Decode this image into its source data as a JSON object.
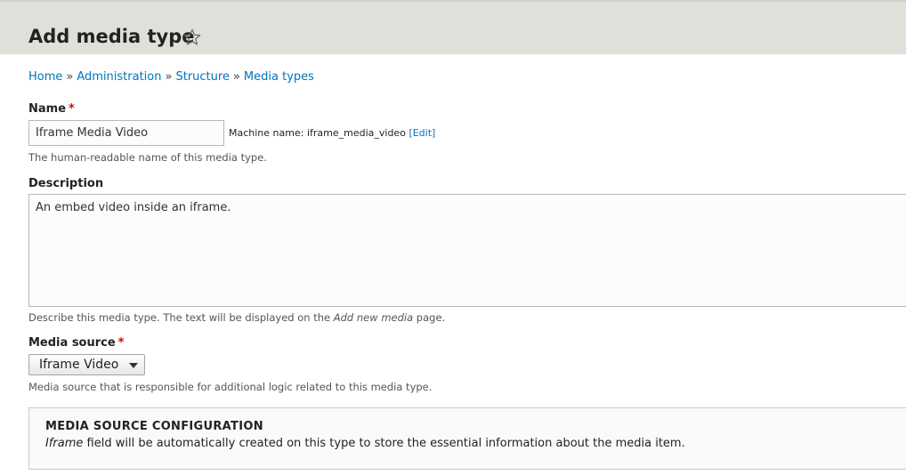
{
  "header": {
    "title": "Add media type",
    "shortcut_icon": "star-outline-icon"
  },
  "breadcrumb": {
    "items": [
      "Home",
      "Administration",
      "Structure",
      "Media types"
    ],
    "separator": "»"
  },
  "name_field": {
    "label": "Name",
    "required_marker": "*",
    "value": "Iframe Media Video",
    "machine_name_prefix": "Machine name: iframe_media_video",
    "machine_name_edit": "[Edit]",
    "help": "The human-readable name of this media type."
  },
  "description_field": {
    "label": "Description",
    "value": "An embed video inside an iframe.",
    "help_prefix": "Describe this media type. The text will be displayed on the",
    "help_emphasis": "Add new media",
    "help_suffix": "page."
  },
  "media_source_field": {
    "label": "Media source",
    "required_marker": "*",
    "selected": "Iframe Video",
    "help": "Media source that is responsible for additional logic related to this media type."
  },
  "config": {
    "title": "MEDIA SOURCE CONFIGURATION",
    "text_emphasis": "Iframe",
    "text_rest": "field will be automatically created on this type to store the essential information about the media item."
  },
  "colors": {
    "header_bg": "#e0dfd9",
    "link": "#0074bd",
    "required": "#e00000"
  }
}
